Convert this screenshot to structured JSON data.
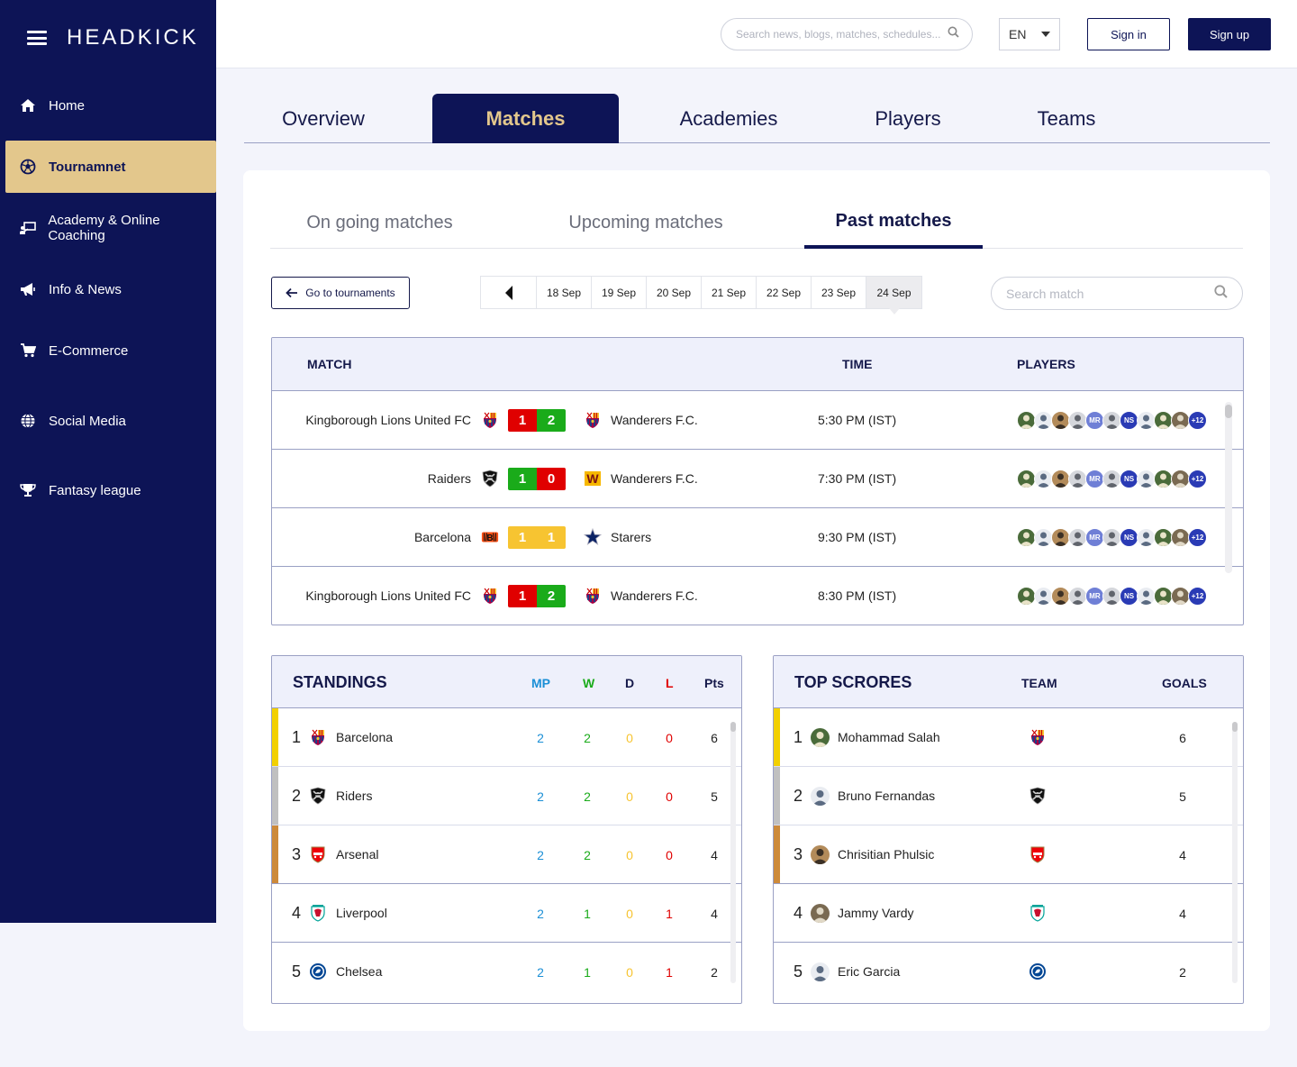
{
  "brand": "HEADKICK",
  "sidebar": {
    "items": [
      {
        "label": "Home",
        "icon": "home-icon"
      },
      {
        "label": "Tournamnet",
        "icon": "soccer-ball-icon",
        "active": true
      },
      {
        "label": "Academy & Online Coaching",
        "icon": "teacher-board-icon"
      },
      {
        "label": "Info & News",
        "icon": "megaphone-icon"
      },
      {
        "label": "E-Commerce",
        "icon": "cart-icon"
      },
      {
        "label": "Social Media",
        "icon": "globe-icon"
      },
      {
        "label": "Fantasy league",
        "icon": "trophy-icon"
      }
    ]
  },
  "header": {
    "search_placeholder": "Search news, blogs, matches, schedules...",
    "language": "EN",
    "signin": "Sign in",
    "signup": "Sign up"
  },
  "main_tabs": [
    "Overview",
    "Matches",
    "Academies",
    "Players",
    "Teams"
  ],
  "main_tab_active": "Matches",
  "sub_tabs": [
    "On going matches",
    "Upcoming matches",
    "Past matches"
  ],
  "sub_tab_active": "Past matches",
  "goto_label": "Go to tournaments",
  "dates": [
    "18 Sep",
    "19 Sep",
    "20 Sep",
    "21 Sep",
    "22 Sep",
    "23 Sep",
    "24 Sep"
  ],
  "selected_date": "24 Sep",
  "match_search_placeholder": "Search match",
  "matches_header": {
    "match": "MATCH",
    "time": "TIME",
    "players": "PLAYERS"
  },
  "matches": [
    {
      "home": "Kingborough Lions United FC",
      "home_crest": "barcelona-crest",
      "home_score": "1",
      "away_score": "2",
      "away": "Wanderers F.C.",
      "away_crest": "barcelona-crest",
      "time": "5:30 PM (IST)",
      "result": "away-win",
      "players_extra": "+12"
    },
    {
      "home": "Raiders",
      "home_crest": "raiders-crest",
      "home_score": "1",
      "away_score": "0",
      "away": "Wanderers F.C.",
      "away_crest": "w-crest",
      "time": "7:30 PM (IST)",
      "result": "home-win",
      "players_extra": "+12"
    },
    {
      "home": "Barcelona",
      "home_crest": "bengals-crest",
      "home_score": "1",
      "away_score": "1",
      "away": "Starers",
      "away_crest": "star-crest",
      "time": "9:30 PM (IST)",
      "result": "draw",
      "players_extra": "+12"
    },
    {
      "home": "Kingborough Lions United FC",
      "home_crest": "barcelona-crest",
      "home_score": "1",
      "away_score": "2",
      "away": "Wanderers F.C.",
      "away_crest": "barcelona-crest",
      "time": "8:30 PM (IST)",
      "result": "away-win",
      "players_extra": "+12"
    }
  ],
  "player_avatar_initials": [
    "MR",
    "NS"
  ],
  "standings": {
    "title": "STANDINGS",
    "columns": [
      "MP",
      "W",
      "D",
      "L",
      "Pts"
    ],
    "rows": [
      {
        "rank": "1",
        "team": "Barcelona",
        "crest": "barcelona-crest",
        "mp": "2",
        "w": "2",
        "d": "0",
        "l": "0",
        "pts": "6"
      },
      {
        "rank": "2",
        "team": "Riders",
        "crest": "raiders-crest",
        "mp": "2",
        "w": "2",
        "d": "0",
        "l": "0",
        "pts": "5"
      },
      {
        "rank": "3",
        "team": "Arsenal",
        "crest": "arsenal-crest",
        "mp": "2",
        "w": "2",
        "d": "0",
        "l": "0",
        "pts": "4"
      },
      {
        "rank": "4",
        "team": "Liverpool",
        "crest": "liverpool-crest",
        "mp": "2",
        "w": "1",
        "d": "0",
        "l": "1",
        "pts": "4"
      },
      {
        "rank": "5",
        "team": "Chelsea",
        "crest": "chelsea-crest",
        "mp": "2",
        "w": "1",
        "d": "0",
        "l": "1",
        "pts": "2"
      }
    ]
  },
  "top_scorers": {
    "title": "TOP SCRORES",
    "columns": [
      "TEAM",
      "GOALS"
    ],
    "rows": [
      {
        "rank": "1",
        "player": "Mohammad Salah",
        "crest": "barcelona-crest",
        "goals": "6"
      },
      {
        "rank": "2",
        "player": "Bruno Fernandas",
        "crest": "raiders-crest",
        "goals": "5"
      },
      {
        "rank": "3",
        "player": "Chrisitian Phulsic",
        "crest": "arsenal-crest",
        "goals": "4"
      },
      {
        "rank": "4",
        "player": "Jammy Vardy",
        "crest": "liverpool-crest",
        "goals": "4"
      },
      {
        "rank": "5",
        "player": "Eric Garcia",
        "crest": "chelsea-crest",
        "goals": "2"
      }
    ]
  },
  "colors": {
    "navy": "#0d1456",
    "gold": "#e3c78c",
    "win": "#1aab1a",
    "loss": "#e00000",
    "draw": "#f7c431",
    "mp": "#1b8fd6",
    "rank1": "#f2d000",
    "rank2": "#c0c0c0",
    "rank3": "#cd8a3a"
  }
}
